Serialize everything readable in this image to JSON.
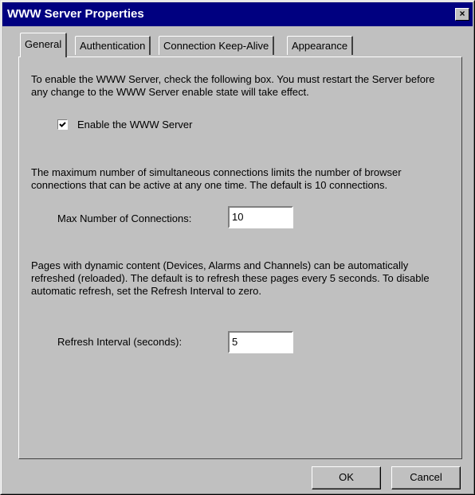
{
  "window": {
    "title": "WWW Server Properties",
    "close_glyph": "×"
  },
  "tabs": [
    {
      "label": "General",
      "active": true
    },
    {
      "label": "Authentication",
      "active": false
    },
    {
      "label": "Connection Keep-Alive",
      "active": false
    },
    {
      "label": "Appearance",
      "active": false
    }
  ],
  "general": {
    "enable_text": "To enable the WWW Server, check the following box. You must restart the Server before any change to the WWW Server enable state will take effect.",
    "enable_label": "Enable the WWW Server",
    "enable_checked": true,
    "connections_text": "The maximum number of simultaneous connections limits the number of browser connections that can be active at any one time. The default is 10 connections.",
    "max_connections_label": "Max Number of Connections:",
    "max_connections_value": "10",
    "refresh_text": "Pages with dynamic content (Devices, Alarms and Channels) can be automatically refreshed (reloaded). The default is to refresh these pages every 5 seconds. To disable automatic refresh, set the Refresh Interval to zero.",
    "refresh_label": "Refresh Interval (seconds):",
    "refresh_value": "5"
  },
  "buttons": {
    "ok": "OK",
    "cancel": "Cancel"
  }
}
